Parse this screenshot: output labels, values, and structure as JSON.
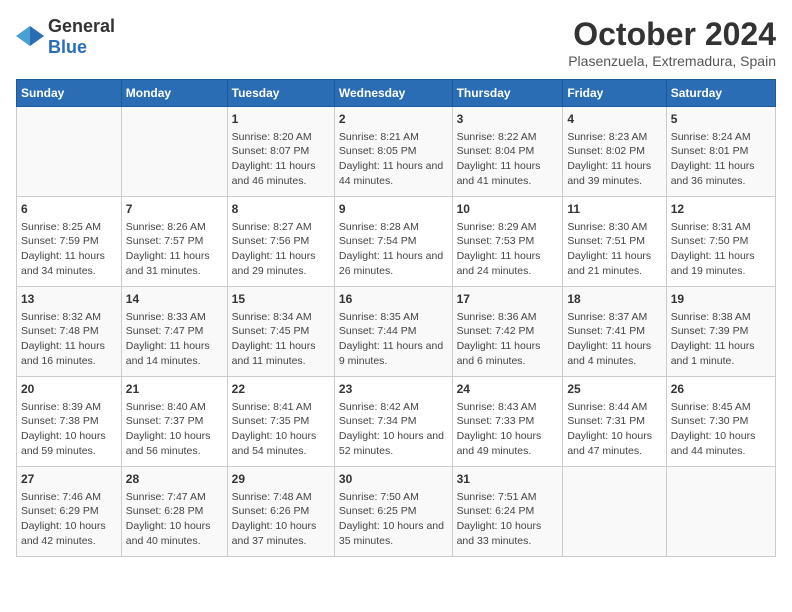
{
  "header": {
    "logo_general": "General",
    "logo_blue": "Blue",
    "month_title": "October 2024",
    "location": "Plasenzuela, Extremadura, Spain"
  },
  "days_of_week": [
    "Sunday",
    "Monday",
    "Tuesday",
    "Wednesday",
    "Thursday",
    "Friday",
    "Saturday"
  ],
  "weeks": [
    [
      {
        "day": "",
        "content": ""
      },
      {
        "day": "",
        "content": ""
      },
      {
        "day": "1",
        "content": "Sunrise: 8:20 AM\nSunset: 8:07 PM\nDaylight: 11 hours and 46 minutes."
      },
      {
        "day": "2",
        "content": "Sunrise: 8:21 AM\nSunset: 8:05 PM\nDaylight: 11 hours and 44 minutes."
      },
      {
        "day": "3",
        "content": "Sunrise: 8:22 AM\nSunset: 8:04 PM\nDaylight: 11 hours and 41 minutes."
      },
      {
        "day": "4",
        "content": "Sunrise: 8:23 AM\nSunset: 8:02 PM\nDaylight: 11 hours and 39 minutes."
      },
      {
        "day": "5",
        "content": "Sunrise: 8:24 AM\nSunset: 8:01 PM\nDaylight: 11 hours and 36 minutes."
      }
    ],
    [
      {
        "day": "6",
        "content": "Sunrise: 8:25 AM\nSunset: 7:59 PM\nDaylight: 11 hours and 34 minutes."
      },
      {
        "day": "7",
        "content": "Sunrise: 8:26 AM\nSunset: 7:57 PM\nDaylight: 11 hours and 31 minutes."
      },
      {
        "day": "8",
        "content": "Sunrise: 8:27 AM\nSunset: 7:56 PM\nDaylight: 11 hours and 29 minutes."
      },
      {
        "day": "9",
        "content": "Sunrise: 8:28 AM\nSunset: 7:54 PM\nDaylight: 11 hours and 26 minutes."
      },
      {
        "day": "10",
        "content": "Sunrise: 8:29 AM\nSunset: 7:53 PM\nDaylight: 11 hours and 24 minutes."
      },
      {
        "day": "11",
        "content": "Sunrise: 8:30 AM\nSunset: 7:51 PM\nDaylight: 11 hours and 21 minutes."
      },
      {
        "day": "12",
        "content": "Sunrise: 8:31 AM\nSunset: 7:50 PM\nDaylight: 11 hours and 19 minutes."
      }
    ],
    [
      {
        "day": "13",
        "content": "Sunrise: 8:32 AM\nSunset: 7:48 PM\nDaylight: 11 hours and 16 minutes."
      },
      {
        "day": "14",
        "content": "Sunrise: 8:33 AM\nSunset: 7:47 PM\nDaylight: 11 hours and 14 minutes."
      },
      {
        "day": "15",
        "content": "Sunrise: 8:34 AM\nSunset: 7:45 PM\nDaylight: 11 hours and 11 minutes."
      },
      {
        "day": "16",
        "content": "Sunrise: 8:35 AM\nSunset: 7:44 PM\nDaylight: 11 hours and 9 minutes."
      },
      {
        "day": "17",
        "content": "Sunrise: 8:36 AM\nSunset: 7:42 PM\nDaylight: 11 hours and 6 minutes."
      },
      {
        "day": "18",
        "content": "Sunrise: 8:37 AM\nSunset: 7:41 PM\nDaylight: 11 hours and 4 minutes."
      },
      {
        "day": "19",
        "content": "Sunrise: 8:38 AM\nSunset: 7:39 PM\nDaylight: 11 hours and 1 minute."
      }
    ],
    [
      {
        "day": "20",
        "content": "Sunrise: 8:39 AM\nSunset: 7:38 PM\nDaylight: 10 hours and 59 minutes."
      },
      {
        "day": "21",
        "content": "Sunrise: 8:40 AM\nSunset: 7:37 PM\nDaylight: 10 hours and 56 minutes."
      },
      {
        "day": "22",
        "content": "Sunrise: 8:41 AM\nSunset: 7:35 PM\nDaylight: 10 hours and 54 minutes."
      },
      {
        "day": "23",
        "content": "Sunrise: 8:42 AM\nSunset: 7:34 PM\nDaylight: 10 hours and 52 minutes."
      },
      {
        "day": "24",
        "content": "Sunrise: 8:43 AM\nSunset: 7:33 PM\nDaylight: 10 hours and 49 minutes."
      },
      {
        "day": "25",
        "content": "Sunrise: 8:44 AM\nSunset: 7:31 PM\nDaylight: 10 hours and 47 minutes."
      },
      {
        "day": "26",
        "content": "Sunrise: 8:45 AM\nSunset: 7:30 PM\nDaylight: 10 hours and 44 minutes."
      }
    ],
    [
      {
        "day": "27",
        "content": "Sunrise: 7:46 AM\nSunset: 6:29 PM\nDaylight: 10 hours and 42 minutes."
      },
      {
        "day": "28",
        "content": "Sunrise: 7:47 AM\nSunset: 6:28 PM\nDaylight: 10 hours and 40 minutes."
      },
      {
        "day": "29",
        "content": "Sunrise: 7:48 AM\nSunset: 6:26 PM\nDaylight: 10 hours and 37 minutes."
      },
      {
        "day": "30",
        "content": "Sunrise: 7:50 AM\nSunset: 6:25 PM\nDaylight: 10 hours and 35 minutes."
      },
      {
        "day": "31",
        "content": "Sunrise: 7:51 AM\nSunset: 6:24 PM\nDaylight: 10 hours and 33 minutes."
      },
      {
        "day": "",
        "content": ""
      },
      {
        "day": "",
        "content": ""
      }
    ]
  ]
}
